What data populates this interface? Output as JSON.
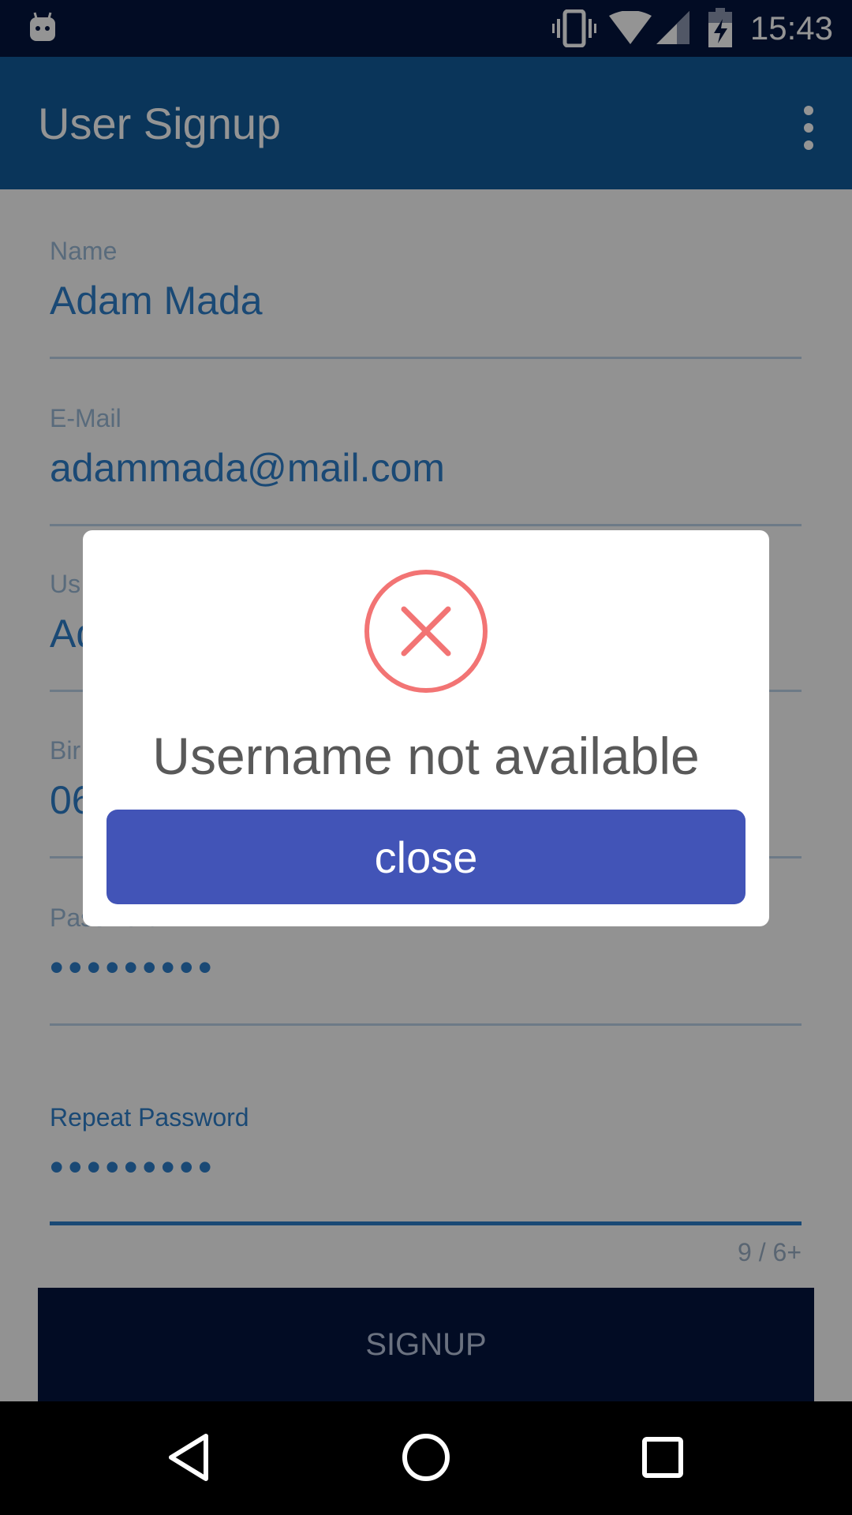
{
  "status_bar": {
    "time": "15:43",
    "icons": [
      "android-debug-icon",
      "vibrate-icon",
      "wifi-icon",
      "cell-signal-icon",
      "battery-charging-icon"
    ]
  },
  "app_bar": {
    "title": "User Signup",
    "overflow_icon": "more-vert-icon"
  },
  "form": {
    "name": {
      "label": "Name",
      "value": "Adam Mada"
    },
    "email": {
      "label": "E-Mail",
      "value": "adammada@mail.com"
    },
    "username": {
      "label": "Us",
      "value": "Ad"
    },
    "birthdate": {
      "label": "Bir",
      "value": "06"
    },
    "password": {
      "label": "Password",
      "value": "•••••••••"
    },
    "repeat_password": {
      "label": "Repeat Password",
      "value": "•••••••••"
    },
    "counter": "9 / 6+",
    "signup_label": "SIGNUP"
  },
  "dialog": {
    "icon": "error-x-circle-icon",
    "message": "Username not available",
    "close_label": "close",
    "accent_color": "#4254b7",
    "error_color": "#f27474"
  },
  "nav_bar": {
    "icons": [
      "back-icon",
      "home-icon",
      "recents-icon"
    ]
  },
  "colors": {
    "primary": "#125c9c",
    "status_bar": "#05163f",
    "field_text": "#2d7fca"
  }
}
